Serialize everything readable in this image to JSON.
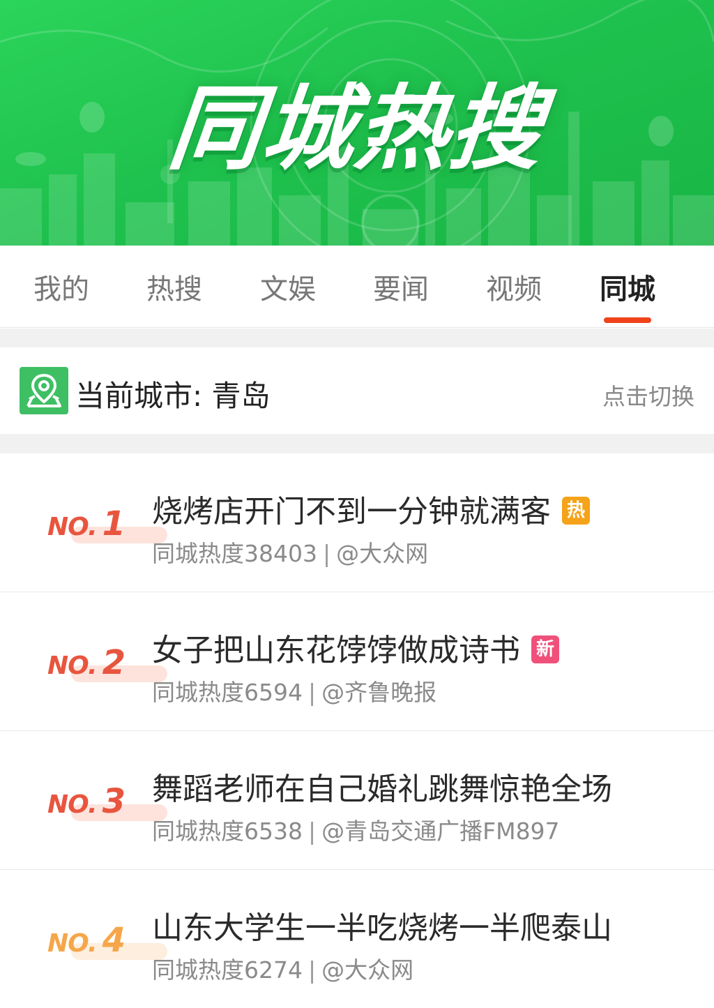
{
  "banner": {
    "title": "同城热搜"
  },
  "tabs": [
    {
      "label": "我的"
    },
    {
      "label": "热搜"
    },
    {
      "label": "文娱"
    },
    {
      "label": "要闻"
    },
    {
      "label": "视频"
    },
    {
      "label": "同城",
      "active": true
    }
  ],
  "city": {
    "label": "当前城市: 青岛",
    "switch_label": "点击切换",
    "icon": "map-pin-icon"
  },
  "list": [
    {
      "rank_prefix": "NO.",
      "rank": "1",
      "title": "烧烤店开门不到一分钟就满客",
      "badge": "热",
      "badge_color": "#f5a31a",
      "heat": "同城热度38403",
      "separator": "|",
      "source": "@大众网",
      "rank_color": "#e8553e",
      "bar_color": "#fde3dc"
    },
    {
      "rank_prefix": "NO.",
      "rank": "2",
      "title": "女子把山东花饽饽做成诗书",
      "badge": "新",
      "badge_color": "#f0507a",
      "heat": "同城热度6594",
      "separator": "|",
      "source": "@齐鲁晚报",
      "rank_color": "#e8553e",
      "bar_color": "#fde3dc"
    },
    {
      "rank_prefix": "NO.",
      "rank": "3",
      "title": "舞蹈老师在自己婚礼跳舞惊艳全场",
      "badge": "",
      "badge_color": "",
      "heat": "同城热度6538",
      "separator": "|",
      "source": "@青岛交通广播FM897",
      "rank_color": "#e8553e",
      "bar_color": "#fde3dc"
    },
    {
      "rank_prefix": "NO.",
      "rank": "4",
      "title": "山东大学生一半吃烧烤一半爬泰山",
      "badge": "",
      "badge_color": "",
      "heat": "同城热度6274",
      "separator": "|",
      "source": "@大众网",
      "rank_color": "#f6a64a",
      "bar_color": "#fdeede"
    }
  ],
  "colors": {
    "accent": "#f0421b",
    "banner_green": "#1fc24e"
  }
}
